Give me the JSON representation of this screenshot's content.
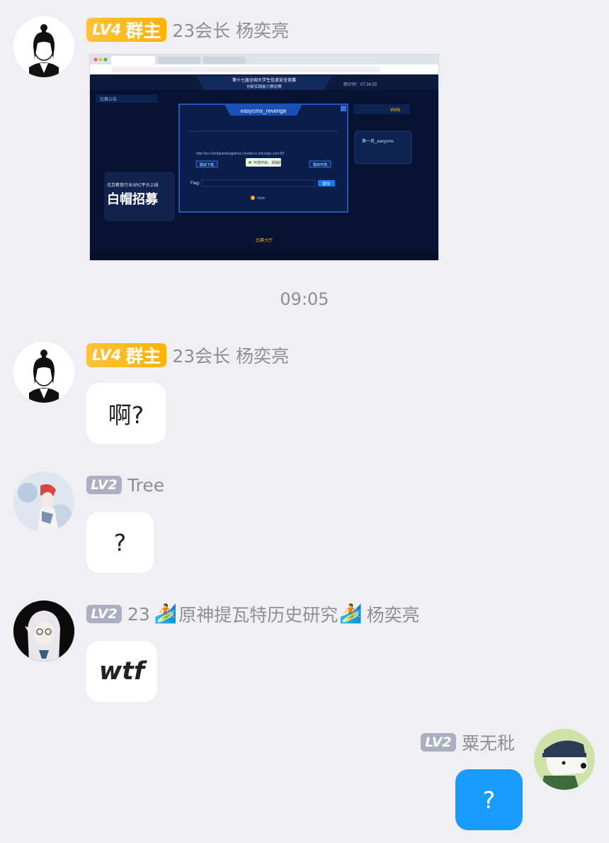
{
  "messages": [
    {
      "level": "LV4",
      "role_badge": "群主",
      "sender": "23会长 杨奕亮",
      "type": "image",
      "image": {
        "browser_title": "easycms_revenge",
        "banner_line1": "第十七届全国大学生信息安全竞赛",
        "banner_line2": "创新实践能力赛初赛",
        "timer": "倒计时：07:34:55",
        "category_tab": "Web",
        "challenge_item": "第一名_easycms",
        "flag_label": "Flag:",
        "submit_label": "提交",
        "toast_text": "环境开启，请稍后…",
        "footer_brand": "Hello",
        "left_promo_title": "白帽招募",
        "left_promo_sub": "北京教育行业SRC平台上线",
        "tab_active": "比赛大厅",
        "download_button": "题目下载",
        "destroy_button": "题目环境",
        "env_url": "http://eci-2ze9quknlkzgjafxvs.cloudeci1.ichunqiu.com:80",
        "notice_title": "比赛公告"
      }
    },
    {
      "time": "09:05"
    },
    {
      "level": "LV4",
      "role_badge": "群主",
      "sender": "23会长 杨奕亮",
      "text": "啊?"
    },
    {
      "level": "LV2",
      "sender": "Tree",
      "text": "?"
    },
    {
      "level": "LV2",
      "sender_prefix": "23",
      "sender_middle": "原神提瓦特历史研究",
      "sender_suffix": "杨奕亮",
      "surf_icon": "🏄",
      "text": "wtf"
    },
    {
      "level": "LV2",
      "sender": "粟无秕",
      "text": "?",
      "self": true
    }
  ],
  "colors": {
    "background": "#efeff4",
    "self_bubble": "#1a9cff",
    "lv4_badge": "#ffb300",
    "lv2_badge": "#aab0c2"
  }
}
